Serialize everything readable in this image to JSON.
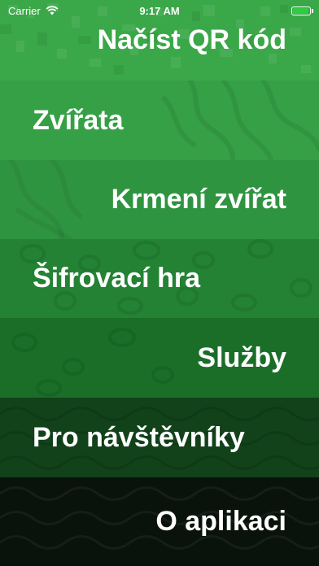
{
  "status_bar": {
    "carrier": "Carrier",
    "time": "9:17 AM",
    "battery_level": 1.0,
    "battery_color": "#2ecc40"
  },
  "menu": {
    "items": [
      {
        "label": "Načíst QR kód",
        "align": "right",
        "color": "#3aa848"
      },
      {
        "label": "Zvířata",
        "align": "left",
        "color": "#35a045"
      },
      {
        "label": "Krmení zvířat",
        "align": "right",
        "color": "#2f9440"
      },
      {
        "label": "Šifrovací hra",
        "align": "left",
        "color": "#238233"
      },
      {
        "label": "Služby",
        "align": "right",
        "color": "#1a6e28"
      },
      {
        "label": "Pro návštěvníky",
        "align": "left",
        "color": "#12421a"
      },
      {
        "label": "O aplikaci",
        "align": "right",
        "color": "#0a130b"
      }
    ]
  },
  "icons": {
    "wifi": "wifi-icon",
    "battery": "battery-icon"
  }
}
